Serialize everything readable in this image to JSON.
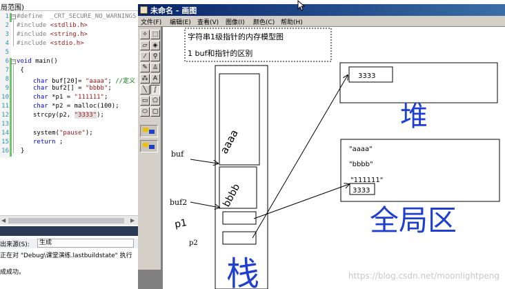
{
  "editor": {
    "tab_label": "局范围)",
    "line_numbers": [
      "1",
      "2",
      "3",
      "4",
      "5",
      "6",
      "7",
      "8",
      "9",
      "10",
      "11",
      "12",
      "13",
      "14",
      "15",
      "16"
    ],
    "lines": {
      "l1": {
        "pp": "#define  ",
        "rest": "_CRT_SECURE_NO_WARNINGS"
      },
      "l2": {
        "pp": "#include ",
        "str": "<stdlib.h>"
      },
      "l3": {
        "pp": "#include ",
        "str": "<string.h>"
      },
      "l4": {
        "pp": "#include ",
        "str": "<stdio.h>"
      },
      "l6": {
        "kw": "void",
        "rest": " main()"
      },
      "l7": {
        "rest": " {"
      },
      "l8": {
        "kw": "char",
        "a": " buf[20]= ",
        "str": "\"aaaa\"",
        "b": "; ",
        "cm": "//定义"
      },
      "l9": {
        "kw": "char",
        "a": " buf2[] = ",
        "str": "\"bbbb\"",
        "b": ";"
      },
      "l10": {
        "kw": "char",
        "a": " *p1 = ",
        "str": "\"111111\"",
        "b": ";"
      },
      "l11": {
        "kw": "char",
        "a": " *p2 = malloc(100);"
      },
      "l12": {
        "a": "strcpy(p2, ",
        "str": "\"3333\"",
        "b": ");"
      },
      "l14": {
        "a": "system(",
        "str": "\"pause\"",
        "b": ");"
      },
      "l15": {
        "kw": "return",
        "a": " ;"
      },
      "l16": {
        "rest": "}"
      }
    }
  },
  "output": {
    "source_label": "出来源(S):",
    "source_value": "生成",
    "lines": [
      "正在对 \"Debug\\课堂演练.lastbuildstate\" 执行",
      "",
      "成成功。"
    ]
  },
  "paint": {
    "title": "未命名 - 画图",
    "menu": [
      "文件(F)",
      "编辑(E)",
      "查看(V)",
      "图像(I)",
      "颜色(C)",
      "帮助(H)"
    ],
    "tools": [
      "free-select-icon",
      "rect-select-icon",
      "eraser-icon",
      "fill-icon",
      "color-picker-icon",
      "magnifier-icon",
      "pencil-icon",
      "brush-icon",
      "airbrush-icon",
      "text-icon",
      "line-icon",
      "curve-icon",
      "rectangle-icon",
      "polygon-icon",
      "ellipse-icon",
      "rounded-rect-icon"
    ]
  },
  "drawing": {
    "title_line": "字符串1级指针的内存模型图",
    "subtitle_line": "1 buf和指针的区别",
    "heap_value": "3333",
    "heap_hand_label": "堆",
    "global_strings": [
      "\"aaaa\"",
      "\"bbbb\"",
      "\"111111\""
    ],
    "global_box_value": "3333",
    "global_hand_label": "全局区",
    "stack_hand_label": "栈",
    "var_labels": [
      "buf",
      "buf2",
      "p1",
      "p2"
    ],
    "buf_content": "aaaa",
    "buf2_content": "bbbb"
  },
  "watermark": "https://blog.csdn.net/moonlightpeng"
}
